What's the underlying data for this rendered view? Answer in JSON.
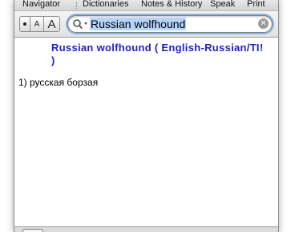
{
  "toolbar": {
    "navigator": "Navigator",
    "dictionaries": "Dictionaries",
    "notes_history": "Notes & History",
    "speak": "Speak",
    "print": "Print"
  },
  "font_buttons": {
    "small": "A",
    "medium": "A",
    "large": "A"
  },
  "search": {
    "query": "Russian wolfhound",
    "icon": "magnifier-icon",
    "clear_icon": "clear-icon"
  },
  "entry": {
    "headword": "Russian wolfhound  ( English-Russian/TI! )",
    "translation": "1) русская борзая"
  },
  "colors": {
    "headword": "#2020c8",
    "selection": "#b5d4fe",
    "focus_ring": "#8fb4e3"
  }
}
